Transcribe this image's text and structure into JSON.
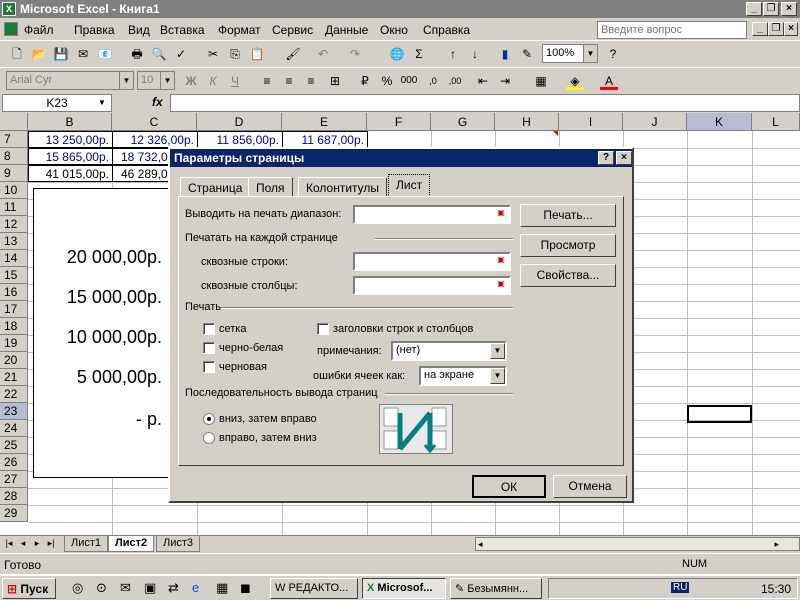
{
  "window": {
    "title": "Microsoft Excel - Книга1"
  },
  "menu": [
    "Файл",
    "Правка",
    "Вид",
    "Вставка",
    "Формат",
    "Сервис",
    "Данные",
    "Окно",
    "Справка"
  ],
  "ask_placeholder": "Введите вопрос",
  "toolbar": {
    "zoom": "100%"
  },
  "format": {
    "font": "Arial Cyr",
    "size": "10"
  },
  "formula": {
    "name_box": "K23",
    "fx": "fx"
  },
  "columns": [
    "B",
    "C",
    "D",
    "E",
    "F",
    "G",
    "H",
    "I",
    "J",
    "K",
    "L"
  ],
  "rows": [
    "7",
    "8",
    "9",
    "10",
    "11",
    "12",
    "13",
    "14",
    "15",
    "16",
    "17",
    "18",
    "19",
    "20",
    "21",
    "22",
    "23",
    "24",
    "25",
    "26",
    "27",
    "28",
    "29"
  ],
  "cells": {
    "r7": [
      "13 250,00р.",
      "12 326,00р.",
      "11 856,00р.",
      "11 687,00р."
    ],
    "r8": [
      "15 865,00р.",
      "18 732,0"
    ],
    "r9": [
      "41 015,00р.",
      "46 289,0"
    ]
  },
  "chart_labels": [
    "20 000,00р.",
    "15 000,00р.",
    "10 000,00р.",
    "5 000,00р.",
    "-    р."
  ],
  "sheets": [
    "Лист1",
    "Лист2",
    "Лист3"
  ],
  "active_sheet": "Лист2",
  "status": {
    "left": "Готово",
    "num": "NUM"
  },
  "taskbar": {
    "start": "Пуск",
    "tasks": [
      "РЕДАКТО...",
      "Microsof...",
      "Безымянн..."
    ],
    "time": "15:30",
    "lang": "RU"
  },
  "dialog": {
    "title": "Параметры страницы",
    "tabs": [
      "Страница",
      "Поля",
      "Колонтитулы",
      "Лист"
    ],
    "print_area_label": "Выводить на печать диапазон:",
    "print_titles_section": "Печатать на каждой странице",
    "rows_label": "сквозные строки:",
    "cols_label": "сквозные столбцы:",
    "print_section": "Печать",
    "gridlines": "сетка",
    "bw": "черно-белая",
    "draft": "черновая",
    "headings": "заголовки строк и столбцов",
    "comments_label": "примечания:",
    "comments_value": "(нет)",
    "errors_label": "ошибки ячеек как:",
    "errors_value": "на экране",
    "order_section": "Последовательность вывода страниц",
    "down_then_over": "вниз, затем вправо",
    "over_then_down": "вправо, затем вниз",
    "btn_print": "Печать...",
    "btn_preview": "Просмотр",
    "btn_props": "Свойства...",
    "btn_ok": "ОК",
    "btn_cancel": "Отмена"
  }
}
